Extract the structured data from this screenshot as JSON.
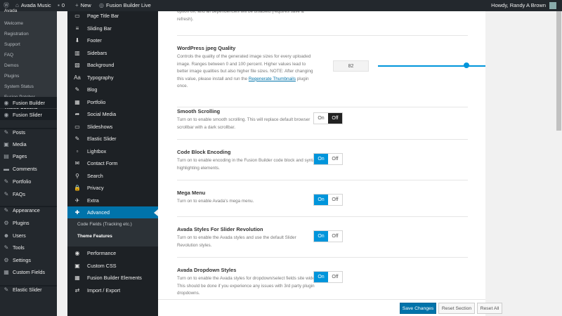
{
  "adminbar": {
    "site_name": "Avada Music",
    "comments_count": "0",
    "new_label": "New",
    "fusion_live_label": "Fusion Builder Live",
    "greeting": "Howdy, Randy A Brown"
  },
  "wp_submenu": [
    {
      "label": "Welcome"
    },
    {
      "label": "Registration"
    },
    {
      "label": "Support"
    },
    {
      "label": "FAQ"
    },
    {
      "label": "Demos"
    },
    {
      "label": "Plugins"
    },
    {
      "label": "System Status"
    },
    {
      "label": "Fusion Patcher"
    },
    {
      "label": "Theme Options"
    }
  ],
  "wp_menu": [
    {
      "label": "Fusion Builder",
      "icon": "fusion-builder-icon"
    },
    {
      "label": "Fusion Slider",
      "icon": "fusion-slider-icon"
    },
    {
      "label": "Posts",
      "icon": "pushpin-icon"
    },
    {
      "label": "Media",
      "icon": "media-icon"
    },
    {
      "label": "Pages",
      "icon": "pages-icon"
    },
    {
      "label": "Comments",
      "icon": "comments-icon"
    },
    {
      "label": "Portfolio",
      "icon": "portfolio-icon"
    },
    {
      "label": "FAQs",
      "icon": "faqs-icon"
    },
    {
      "label": "Appearance",
      "icon": "appearance-icon"
    },
    {
      "label": "Plugins",
      "icon": "plugins-icon"
    },
    {
      "label": "Users",
      "icon": "users-icon"
    },
    {
      "label": "Tools",
      "icon": "tools-icon"
    },
    {
      "label": "Settings",
      "icon": "settings-icon"
    },
    {
      "label": "Custom Fields",
      "icon": "custom-fields-icon"
    },
    {
      "label": "Elastic Slider",
      "icon": "elastic-slider-icon"
    }
  ],
  "avada_menu": [
    {
      "label": "Page Title Bar",
      "icon": "page-title-bar-icon"
    },
    {
      "label": "Sliding Bar",
      "icon": "sliding-bar-icon"
    },
    {
      "label": "Footer",
      "icon": "footer-icon"
    },
    {
      "label": "Sidebars",
      "icon": "sidebars-icon"
    },
    {
      "label": "Background",
      "icon": "background-icon"
    },
    {
      "label": "Typography",
      "icon": "typography-icon"
    },
    {
      "label": "Blog",
      "icon": "blog-icon"
    },
    {
      "label": "Portfolio",
      "icon": "portfolio-grid-icon"
    },
    {
      "label": "Social Media",
      "icon": "share-icon"
    },
    {
      "label": "Slideshows",
      "icon": "slideshows-icon"
    },
    {
      "label": "Elastic Slider",
      "icon": "elastic-slider-icon"
    },
    {
      "label": "Lightbox",
      "icon": "lightbox-icon"
    },
    {
      "label": "Contact Form",
      "icon": "contact-form-icon"
    },
    {
      "label": "Search",
      "icon": "search-icon"
    },
    {
      "label": "Privacy",
      "icon": "lock-icon"
    },
    {
      "label": "Extra",
      "icon": "extra-icon"
    },
    {
      "label": "Advanced",
      "icon": "puzzle-icon"
    }
  ],
  "avada_sub": [
    {
      "label": "Code Fields (Tracking etc.)"
    },
    {
      "label": "Theme Features"
    }
  ],
  "avada_menu_bottom": [
    {
      "label": "Performance",
      "icon": "performance-icon"
    },
    {
      "label": "Custom CSS",
      "icon": "custom-css-icon"
    },
    {
      "label": "Fusion Builder Elements",
      "icon": "fusion-elements-icon"
    },
    {
      "label": "Import / Export",
      "icon": "import-export-icon"
    }
  ],
  "settings": {
    "top_desc": "option off, and all dependencies will be disabled (requires save & refresh).",
    "jpeg": {
      "title": "WordPress jpeg Quality",
      "desc_before": "Controls the quality of the generated image sizes for every uploaded image. Ranges between 0 and 100 percent. Higher values lead to better image qualities but also higher file sizes. NOTE: After changing this value, please install and run the ",
      "link": "Regenerate Thumbnails",
      "desc_after": " plugin once.",
      "value": "82",
      "percent": 82
    },
    "items": [
      {
        "title": "Smooth Scrolling",
        "desc": "Turn on to enable smooth scrolling. This will replace default browser scrollbar with a dark scrollbar.",
        "on": "On",
        "off": "Off",
        "state": "off"
      },
      {
        "title": "Code Block Encoding",
        "desc": "Turn on to enable encoding in the Fusion Builder code block and syntax highlighting elements.",
        "on": "On",
        "off": "Off",
        "state": "on"
      },
      {
        "title": "Mega Menu",
        "desc": "Turn on to enable Avada's mega menu.",
        "on": "On",
        "off": "Off",
        "state": "on"
      },
      {
        "title": "Avada Styles For Slider Revolution",
        "desc": "Turn on to enable the Avada styles and use the default Slider Revolution styles.",
        "on": "On",
        "off": "Off",
        "state": "on"
      },
      {
        "title": "Avada Dropdown Styles",
        "desc": "Turn on to enable the Avada styles for dropdown/select fields site wide. This should be done if you experience any issues with 3rd party plugin dropdowns.",
        "on": "On",
        "off": "Off",
        "state": "on"
      }
    ]
  },
  "footer": {
    "save": "Save Changes",
    "reset_section": "Reset Section",
    "reset_all": "Reset All"
  }
}
